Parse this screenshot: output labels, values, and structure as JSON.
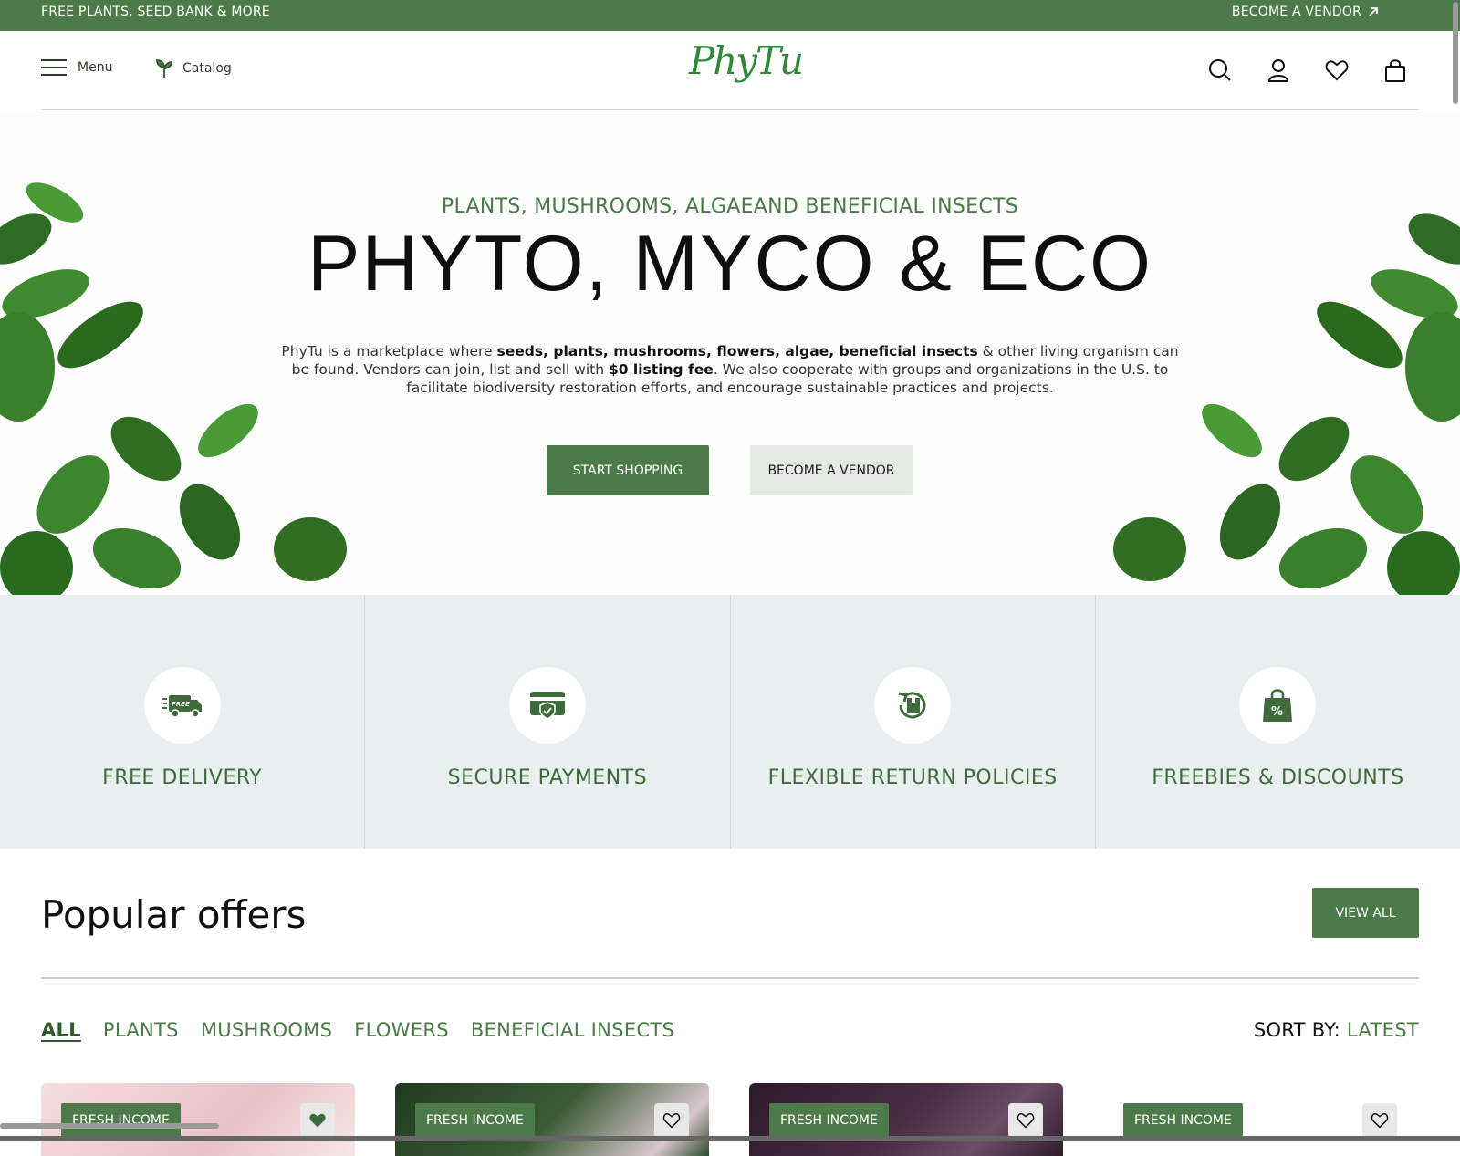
{
  "topbar": {
    "left_text": "FREE PLANTS, SEED BANK & MORE",
    "right_text": "BECOME A VENDOR"
  },
  "header": {
    "menu_label": "Menu",
    "catalog_label": "Catalog",
    "logo_text": "PhyTu",
    "icons": [
      "search-icon",
      "user-icon",
      "heart-icon",
      "shopping-bag-icon"
    ]
  },
  "hero": {
    "eyebrow": "PLANTS, MUSHROOMS, ALGAEAND BENEFICIAL INSECTS",
    "title": "PHYTO, MYCO & ECO",
    "desc_1": "PhyTu is a marketplace where ",
    "desc_bold_1": "seeds, plants, mushrooms, flowers, algae, beneficial insects",
    "desc_2": " & other living organism can be found. Vendors can join, list and sell with ",
    "desc_bold_2": "$0 listing fee",
    "desc_3": ". We also cooperate with groups and organizations in the U.S. to facilitate biodiversity restoration efforts, and encourage sustainable practices and projects.",
    "primary_button": "START SHOPPING",
    "secondary_button": "BECOME A VENDOR"
  },
  "features": [
    {
      "label": "FREE DELIVERY",
      "icon": "delivery-truck-icon"
    },
    {
      "label": "SECURE PAYMENTS",
      "icon": "secure-card-icon"
    },
    {
      "label": "FLEXIBLE RETURN POLICIES",
      "icon": "return-box-icon"
    },
    {
      "label": "FREEBIES & DISCOUNTS",
      "icon": "discount-bag-icon"
    }
  ],
  "popular": {
    "title": "Popular offers",
    "view_all": "VIEW ALL",
    "filters": [
      "ALL",
      "PLANTS",
      "MUSHROOMS",
      "FLOWERS",
      "BENEFICIAL INSECTS"
    ],
    "sort_key": "SORT BY:",
    "sort_value": "LATEST",
    "cards": [
      {
        "badge": "FRESH INCOME",
        "favorited": true,
        "bg": "#f2d4d8"
      },
      {
        "badge": "FRESH INCOME",
        "favorited": false,
        "bg": "#2e4a2e"
      },
      {
        "badge": "FRESH INCOME",
        "favorited": false,
        "bg": "#3a2438"
      },
      {
        "badge": "FRESH INCOME",
        "favorited": false,
        "bg": "#ffffff"
      }
    ]
  },
  "colors": {
    "brand_green": "#4d7a49",
    "feature_bg": "#e8efee",
    "logo_green": "#2e8a3a"
  }
}
